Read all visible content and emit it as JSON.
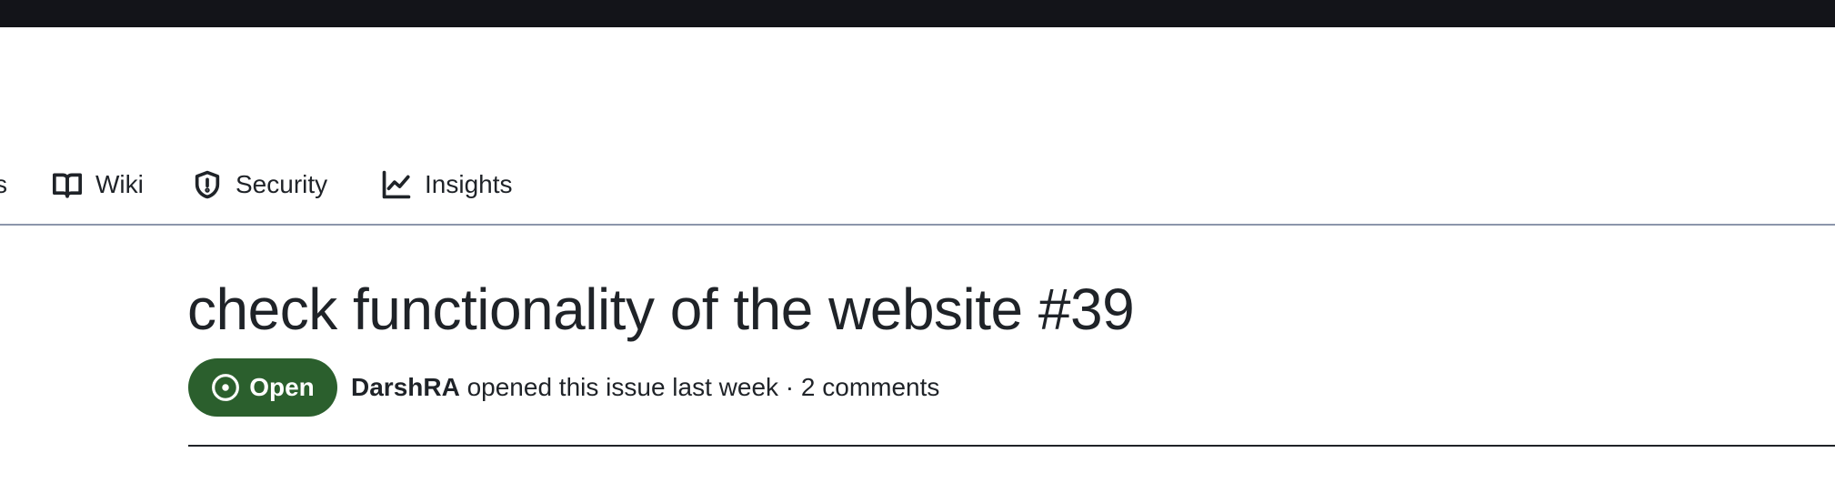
{
  "nav": {
    "cutoff_label": "s",
    "items": [
      {
        "label": "Wiki",
        "icon": "book-icon"
      },
      {
        "label": "Security",
        "icon": "shield-icon"
      },
      {
        "label": "Insights",
        "icon": "graph-icon"
      }
    ]
  },
  "issue": {
    "title": "check functionality of the website",
    "number": "#39",
    "state": "Open",
    "author": "DarshRA",
    "meta_text": "opened this issue last week · 2 comments"
  },
  "colors": {
    "topbar": "#131419",
    "open_badge": "#2b5f2d",
    "text": "#1f2328"
  }
}
